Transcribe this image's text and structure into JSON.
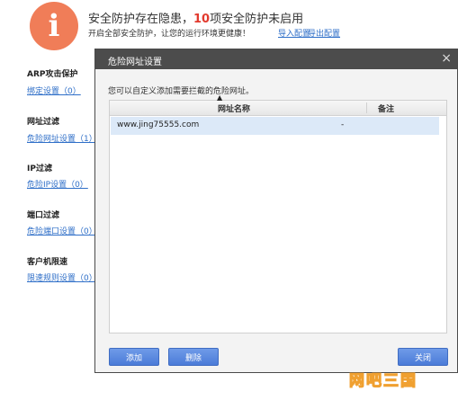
{
  "status": {
    "icon_glyph": "i",
    "headline_before": "安全防护存在隐患，",
    "headline_count": "10",
    "headline_after": "项安全防护未启用",
    "subline": "开启全部安全防护，让您的运行环境更健康！",
    "import_link": "导入配置",
    "export_link": "导出配置"
  },
  "sections": [
    {
      "title": "ARP攻击保护",
      "link": "绑定设置（0）"
    },
    {
      "title": "网址过滤",
      "link": "危险网址设置（1）"
    },
    {
      "title": "IP过滤",
      "link": "危险IP设置（0）"
    },
    {
      "title": "端口过滤",
      "link": "危险端口设置（0）"
    },
    {
      "title": "客户机限速",
      "link": "限速规则设置（0）"
    }
  ],
  "dialog": {
    "title": "危险网址设置",
    "close_glyph": "×",
    "description": "您可以自定义添加需要拦截的危险网址。",
    "columns": [
      "网址名称",
      "备注"
    ],
    "rows": [
      {
        "url": "www.jing75555.com",
        "note": "-"
      }
    ],
    "add_button": "添加",
    "delete_button": "删除",
    "close_button": "关闭"
  },
  "watermark": "网吧三国",
  "colors": {
    "warning": "#f07d58",
    "accent_count": "#e23a2e",
    "link": "#2f6fc8",
    "titlebar": "#4c4c4c",
    "button": "#5a87e0",
    "row_selected": "#dce9f8"
  }
}
